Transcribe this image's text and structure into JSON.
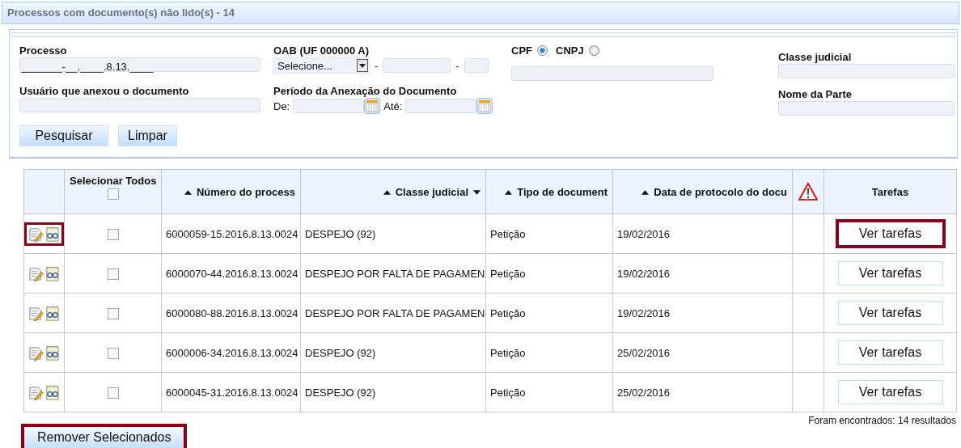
{
  "title": "Processos com documento(s) não lido(s) - 14",
  "form": {
    "processo": {
      "label": "Processo",
      "value": "_______-__.____.8.13.____"
    },
    "oab": {
      "label": "OAB (UF 000000 A)",
      "select": "Selecione...",
      "separators": [
        "-",
        "-"
      ]
    },
    "person_type": [
      {
        "label": "CPF",
        "selected": true
      },
      {
        "label": "CNPJ",
        "selected": false
      }
    ],
    "classe": {
      "label": "Classe judicial"
    },
    "usuario": {
      "label": "Usuário que anexou o documento"
    },
    "periodo": {
      "label": "Período da Anexação do Documento",
      "from_label": "De:",
      "to_label": "Até:"
    },
    "nome_parte": {
      "label": "Nome da Parte"
    },
    "buttons": [
      "Pesquisar",
      "Limpar"
    ]
  },
  "table": {
    "columns": [
      {
        "kind": "icons"
      },
      {
        "kind": "select_all",
        "label": "Selecionar Todos",
        "checked": false
      },
      {
        "kind": "text",
        "label": "Número do process",
        "sortable": true
      },
      {
        "kind": "text",
        "label": "Classe judicial",
        "sortable": true,
        "dropdown": true
      },
      {
        "kind": "text",
        "label": "Tipo de document",
        "sortable": true
      },
      {
        "kind": "text",
        "label": "Data de protocolo do docu",
        "sortable": true
      },
      {
        "kind": "warning"
      },
      {
        "kind": "text",
        "label": "Tarefas"
      }
    ],
    "rows": [
      {
        "highlighted": true,
        "checked": false,
        "numero": "6000059-15.2016.8.13.0024",
        "classe": "DESPEJO (92)",
        "tipo": "Petição",
        "data": "19/02/2016",
        "action": "Ver tarefas",
        "action_highlighted": true
      },
      {
        "highlighted": false,
        "checked": false,
        "numero": "6000070-44.2016.8.13.0024",
        "classe": "DESPEJO POR FALTA DE PAGAMEN",
        "tipo": "Petição",
        "data": "19/02/2016",
        "action": "Ver tarefas",
        "action_highlighted": false
      },
      {
        "highlighted": false,
        "checked": false,
        "numero": "6000080-88.2016.8.13.0024",
        "classe": "DESPEJO POR FALTA DE PAGAMEN",
        "tipo": "Petição",
        "data": "19/02/2016",
        "action": "Ver tarefas",
        "action_highlighted": false
      },
      {
        "highlighted": false,
        "checked": false,
        "numero": "6000006-34.2016.8.13.0024",
        "classe": "DESPEJO (92)",
        "tipo": "Petição",
        "data": "25/02/2016",
        "action": "Ver tarefas",
        "action_highlighted": false
      },
      {
        "highlighted": false,
        "checked": false,
        "numero": "6000045-31.2016.8.13.0024",
        "classe": "DESPEJO (92)",
        "tipo": "Petição",
        "data": "25/02/2016",
        "action": "Ver tarefas",
        "action_highlighted": false
      }
    ]
  },
  "result_count": "Foram encontrados: 14 resultados",
  "remove_button": {
    "label": "Remover Selecionados",
    "highlighted": true
  }
}
